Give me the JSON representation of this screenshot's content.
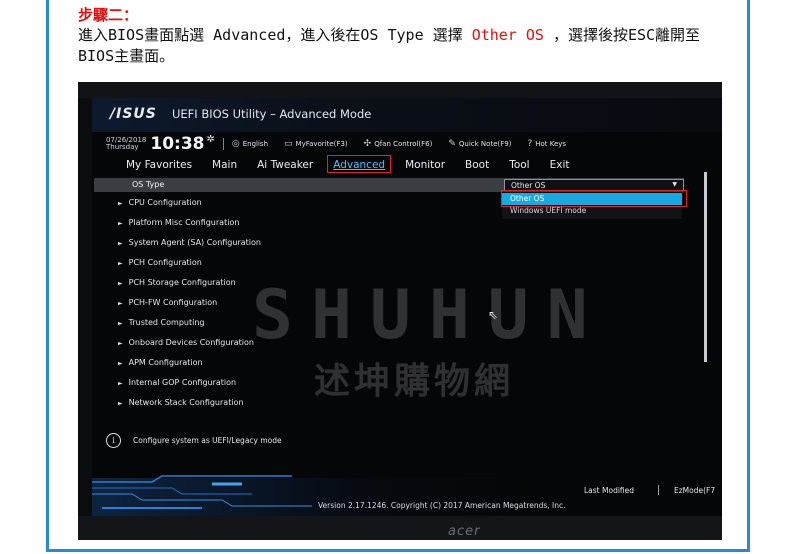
{
  "article": {
    "step_title": "步驟二：",
    "instruction_pre": "進入BIOS畫面點選 Advanced，進入後在OS Type 選擇 ",
    "instruction_highlight": "Other OS",
    "instruction_post": " ，選擇後按ESC離開至BIOS主畫面。"
  },
  "colors": {
    "highlight_red": "#e01010",
    "bios_accent": "#18aadf",
    "frame_blue": "#2a88d8"
  },
  "bios": {
    "logo": "/ISUS",
    "title": "UEFI BIOS Utility – Advanced Mode",
    "date": "07/26/2018",
    "weekday": "Thursday",
    "time": "10:38",
    "toolbar": [
      {
        "icon": "globe-icon",
        "glyph": "◎",
        "label": "English"
      },
      {
        "icon": "favorite-icon",
        "glyph": "▭",
        "label": "MyFavorite(F3)"
      },
      {
        "icon": "fan-icon",
        "glyph": "✣",
        "label": "Qfan Control(F6)"
      },
      {
        "icon": "note-icon",
        "glyph": "✎",
        "label": "Quick Note(F9)"
      },
      {
        "icon": "hotkeys-icon",
        "glyph": "?",
        "label": "Hot Keys"
      }
    ],
    "tabs": [
      "My Favorites",
      "Main",
      "Ai Tweaker",
      "Advanced",
      "Monitor",
      "Boot",
      "Tool",
      "Exit"
    ],
    "active_tab": "Advanced",
    "os_type": {
      "label": "OS Type",
      "value": "Other OS"
    },
    "dropdown_options": [
      "Other OS",
      "Windows UEFI mode"
    ],
    "menu_items": [
      "CPU Configuration",
      "Platform Misc Configuration",
      "System Agent (SA) Configuration",
      "PCH Configuration",
      "PCH Storage Configuration",
      "PCH-FW Configuration",
      "Trusted Computing",
      "Onboard Devices Configuration",
      "APM Configuration",
      "Internal GOP Configuration",
      "Network Stack Configuration"
    ],
    "help_text": "Configure system as UEFI/Legacy mode",
    "footer": {
      "last_modified": "Last Modified",
      "ezmode": "EzMode(F7",
      "version": "Version 2.17.1246. Copyright (C) 2017 American Megatrends, Inc."
    }
  },
  "watermark": {
    "latin": "SHUHUN",
    "chinese": "述坤購物網"
  },
  "monitor_brand": "acer"
}
